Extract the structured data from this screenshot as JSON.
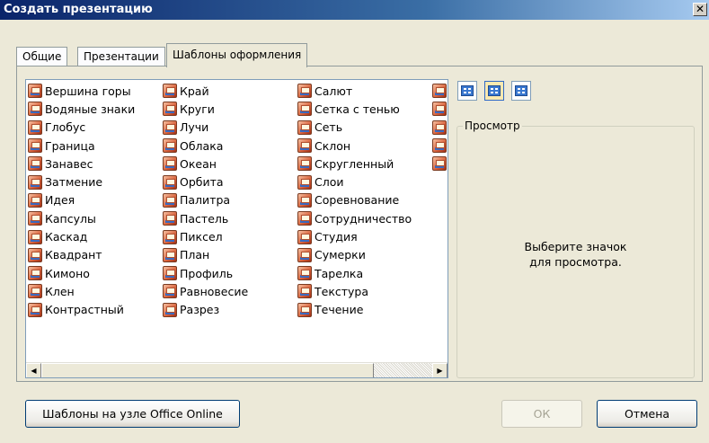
{
  "window": {
    "title": "Создать презентацию",
    "close_glyph": "✕"
  },
  "tabs": [
    {
      "label": "Общие"
    },
    {
      "label": "Презентации"
    },
    {
      "label": "Шаблоны оформления",
      "active": true
    }
  ],
  "templates": {
    "columns": [
      [
        "Вершина горы",
        "Водяные знаки",
        "Глобус",
        "Граница",
        "Занавес",
        "Затмение",
        "Идея",
        "Капсулы",
        "Каскад",
        "Квадрант",
        "Кимоно",
        "Клен",
        "Контрастный"
      ],
      [
        "Край",
        "Круги",
        "Лучи",
        "Облака",
        "Океан",
        "Орбита",
        "Палитра",
        "Пастель",
        "Пиксел",
        "План",
        "Профиль",
        "Равновесие",
        "Разрез"
      ],
      [
        "Салют",
        "Сетка с тенью",
        "Сеть",
        "Склон",
        "Скругленный",
        "Слои",
        "Соревнование",
        "Сотрудничество",
        "Студия",
        "Сумерки",
        "Тарелка",
        "Текстура",
        "Течение"
      ],
      [
        "",
        "",
        "",
        "",
        ""
      ]
    ],
    "icon": "presentation-template-icon"
  },
  "view_buttons": [
    {
      "name": "large-icons-view-icon"
    },
    {
      "name": "list-view-icon",
      "active": true
    },
    {
      "name": "details-view-icon"
    }
  ],
  "preview": {
    "legend": "Просмотр",
    "message_line1": "Выберите значок",
    "message_line2": "для просмотра."
  },
  "buttons": {
    "office_online": "Шаблоны на узле Office Online",
    "ok": "ОК",
    "cancel": "Отмена"
  },
  "scrollbar": {
    "left_arrow": "◀",
    "right_arrow": "▶"
  }
}
